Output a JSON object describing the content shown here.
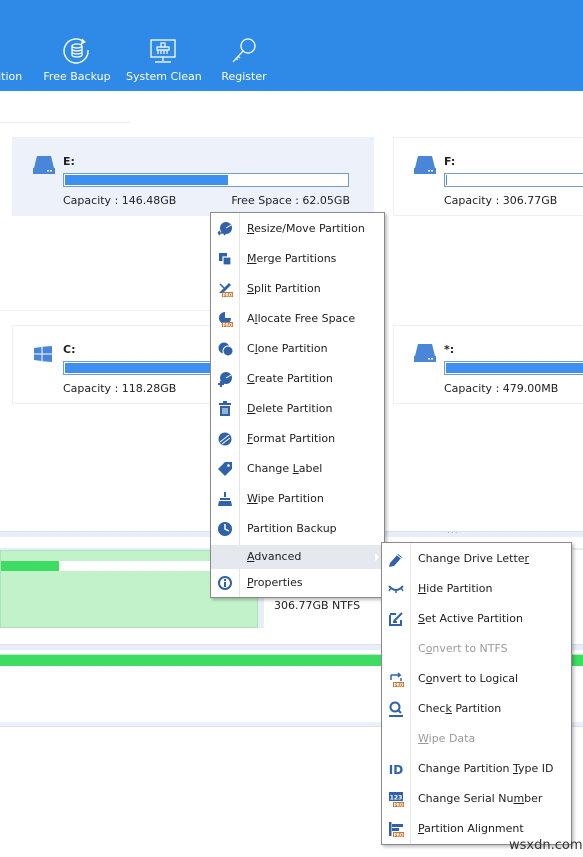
{
  "toolbar": {
    "items": [
      {
        "label": "tition",
        "icon": "partition-icon"
      },
      {
        "label": "Free Backup",
        "icon": "backup-icon"
      },
      {
        "label": "System Clean",
        "icon": "system-clean-icon"
      },
      {
        "label": "Register",
        "icon": "key-icon"
      }
    ]
  },
  "cards": [
    {
      "name": "E:",
      "capacity": "Capacity : 146.48GB",
      "free_space": "Free Space : 62.05GB",
      "used_fraction": 0.58,
      "icon": "drive-icon",
      "selected": true
    },
    {
      "name": "F:",
      "capacity": "Capacity : 306.77GB",
      "used_fraction": 0.0,
      "icon": "drive-icon"
    },
    {
      "name": "C:",
      "capacity": "Capacity : 118.28GB",
      "used_fraction": 1.0,
      "icon": "windows-icon"
    },
    {
      "name": "*:",
      "capacity": "Capacity : 479.00MB",
      "used_fraction": 1.0,
      "icon": "drive-icon"
    }
  ],
  "disk_map": {
    "partition_label": "306.77GB NTFS",
    "splitter": "..."
  },
  "context_menu": {
    "items": [
      {
        "pre": "",
        "key": "R",
        "post": "esize/Move Partition",
        "icon": "resize-move-icon"
      },
      {
        "pre": "",
        "key": "M",
        "post": "erge Partitions",
        "icon": "merge-icon"
      },
      {
        "pre": "",
        "key": "S",
        "post": "plit Partition",
        "icon": "split-pro-icon"
      },
      {
        "pre": "A",
        "key": "l",
        "post": "locate Free Space",
        "icon": "allocate-pro-icon"
      },
      {
        "pre": "C",
        "key": "l",
        "post": "one Partition",
        "icon": "clone-icon"
      },
      {
        "pre": "",
        "key": "C",
        "post": "reate Partition",
        "icon": "create-icon"
      },
      {
        "pre": "",
        "key": "D",
        "post": "elete Partition",
        "icon": "delete-icon"
      },
      {
        "pre": "",
        "key": "F",
        "post": "ormat Partition",
        "icon": "format-icon"
      },
      {
        "pre": "Change ",
        "key": "L",
        "post": "abel",
        "icon": "label-icon"
      },
      {
        "pre": "",
        "key": "W",
        "post": "ipe Partition",
        "icon": "wipe-icon"
      },
      {
        "pre": "Partition Backup",
        "key": "",
        "post": "",
        "icon": "backup-small-icon"
      },
      {
        "pre": "",
        "key": "A",
        "post": "dvanced",
        "icon": "",
        "submenu": true,
        "hover": true
      },
      {
        "pre": "",
        "key": "P",
        "post": "roperties",
        "icon": "info-icon"
      }
    ]
  },
  "submenu": {
    "items": [
      {
        "pre": "Change Drive Lette",
        "key": "r",
        "post": "",
        "icon": "pencil-icon"
      },
      {
        "pre": "",
        "key": "H",
        "post": "ide Partition",
        "icon": "hide-icon"
      },
      {
        "pre": "",
        "key": "S",
        "post": "et Active Partition",
        "icon": "set-active-icon"
      },
      {
        "pre": "C",
        "key": "o",
        "post": "nvert to NTFS",
        "icon": "",
        "disabled": true
      },
      {
        "pre": "C",
        "key": "o",
        "post": "nvert to Logical",
        "icon": "convert-pro-icon"
      },
      {
        "pre": "Chec",
        "key": "k",
        "post": " Partition",
        "icon": "check-icon"
      },
      {
        "pre": "",
        "key": "W",
        "post": "ipe Data",
        "icon": "",
        "disabled": true
      },
      {
        "pre": "Change Partition ",
        "key": "T",
        "post": "ype ID",
        "icon": "id-icon"
      },
      {
        "pre": "Change Serial Nu",
        "key": "m",
        "post": "ber",
        "icon": "serial-pro-icon"
      },
      {
        "pre": "",
        "key": "P",
        "post": "artition Alignment",
        "icon": "alignment-pro-icon"
      }
    ]
  },
  "watermark": "wsxdn.com",
  "colors": {
    "accent": "#2e8ae6",
    "bar_fill": "#3d8ff0",
    "green": "#3ddc62",
    "icon_blue": "#2f62a8"
  }
}
